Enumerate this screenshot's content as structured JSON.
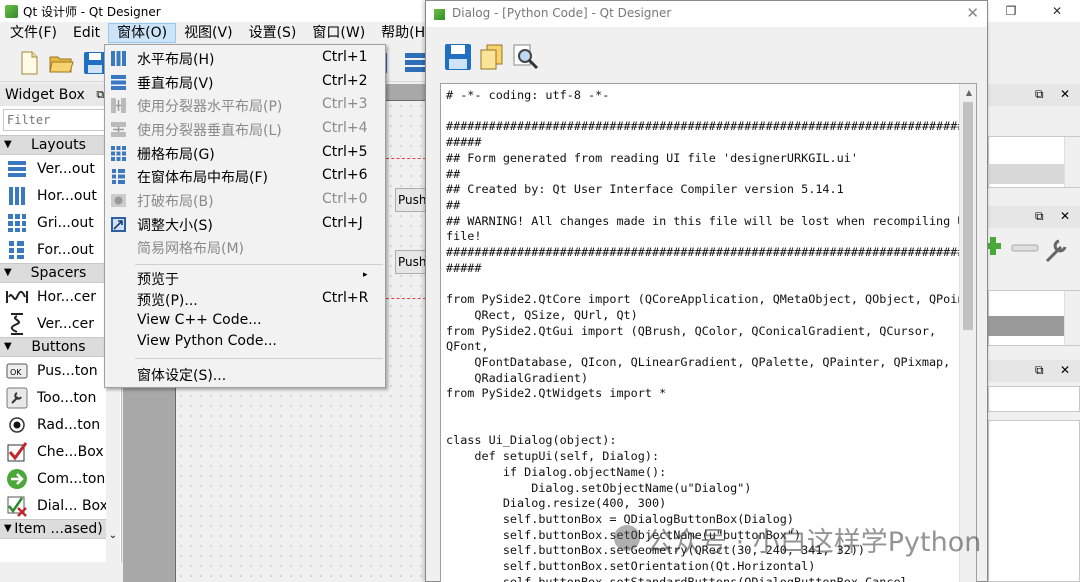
{
  "window": {
    "title": "Qt 设计师 - Qt Designer",
    "controls": [
      "—",
      "❐",
      "✕"
    ]
  },
  "menubar": {
    "items": [
      "文件(F)",
      "Edit",
      "窗体(O)",
      "视图(V)",
      "设置(S)",
      "窗口(W)",
      "帮助(H)"
    ],
    "active_index": 2
  },
  "widget_box": {
    "title": "Widget Box",
    "dock_buttons": "⧉ ✕",
    "filter_placeholder": "Filter",
    "categories": [
      {
        "name": "Layouts",
        "items": [
          "Ver...out",
          "Hor...out",
          "Gri...out",
          "For...out"
        ]
      },
      {
        "name": "Spacers",
        "items": [
          "Hor...cer",
          "Ver...cer"
        ]
      },
      {
        "name": "Buttons",
        "items": [
          "Pus...ton",
          "Too...ton",
          "Rad...ton",
          "Che...Box",
          "Com...ton",
          "Dial... Box"
        ]
      },
      {
        "name": "Item ...ased)",
        "items": []
      }
    ]
  },
  "form_menu": {
    "items": [
      {
        "label": "水平布局(H)",
        "shortcut": "Ctrl+1",
        "enabled": true,
        "icon": "horizontal-layout-icon"
      },
      {
        "label": "垂直布局(V)",
        "shortcut": "Ctrl+2",
        "enabled": true,
        "icon": "vertical-layout-icon"
      },
      {
        "label": "使用分裂器水平布局(P)",
        "shortcut": "Ctrl+3",
        "enabled": false,
        "icon": "splitter-horizontal-icon"
      },
      {
        "label": "使用分裂器垂直布局(L)",
        "shortcut": "Ctrl+4",
        "enabled": false,
        "icon": "splitter-vertical-icon"
      },
      {
        "label": "栅格布局(G)",
        "shortcut": "Ctrl+5",
        "enabled": true,
        "icon": "grid-layout-icon"
      },
      {
        "label": "在窗体布局中布局(F)",
        "shortcut": "Ctrl+6",
        "enabled": true,
        "icon": "form-layout-icon"
      },
      {
        "label": "打破布局(B)",
        "shortcut": "Ctrl+0",
        "enabled": false,
        "icon": "break-layout-icon"
      },
      {
        "label": "调整大小(S)",
        "shortcut": "Ctrl+J",
        "enabled": true,
        "icon": "adjust-size-icon"
      },
      {
        "label": "简易网格布局(M)",
        "shortcut": "",
        "enabled": false,
        "icon": ""
      },
      {
        "label": "预览于",
        "shortcut": "",
        "enabled": true,
        "icon": "",
        "submenu": true
      },
      {
        "label": "预览(P)...",
        "shortcut": "Ctrl+R",
        "enabled": true,
        "icon": ""
      },
      {
        "label": "View C++ Code...",
        "shortcut": "",
        "enabled": true,
        "icon": ""
      },
      {
        "label": "View Python Code...",
        "shortcut": "",
        "enabled": true,
        "icon": ""
      },
      {
        "label": "窗体设定(S)...",
        "shortcut": "",
        "enabled": true,
        "icon": ""
      }
    ]
  },
  "canvas": {
    "buttons": [
      "Push",
      "Push"
    ]
  },
  "dialog": {
    "title": "Dialog - [Python Code] - Qt Designer",
    "close": "✕",
    "toolbar": [
      "save-icon",
      "copy-icon",
      "find-icon"
    ],
    "code": "# -*- coding: utf-8 -*-\n\n################################################################################\n#####\n## Form generated from reading UI file 'designerURKGIL.ui'\n##\n## Created by: Qt User Interface Compiler version 5.14.1\n##\n## WARNING! All changes made in this file will be lost when recompiling UI\nfile!\n################################################################################\n#####\n\nfrom PySide2.QtCore import (QCoreApplication, QMetaObject, QObject, QPoint,\n    QRect, QSize, QUrl, Qt)\nfrom PySide2.QtGui import (QBrush, QColor, QConicalGradient, QCursor,\nQFont,\n    QFontDatabase, QIcon, QLinearGradient, QPalette, QPainter, QPixmap,\n    QRadialGradient)\nfrom PySide2.QtWidgets import *\n\n\nclass Ui_Dialog(object):\n    def setupUi(self, Dialog):\n        if Dialog.objectName():\n            Dialog.setObjectName(u\"Dialog\")\n        Dialog.resize(400, 300)\n        self.buttonBox = QDialogButtonBox(Dialog)\n        self.buttonBox.setObjectName(u\"buttonBox\")\n        self.buttonBox.setGeometry(QRect(30, 240, 341, 32))\n        self.buttonBox.setOrientation(Qt.Horizontal)\n        self.buttonBox.setStandardButtons(QDialogButtonBox.Cancel"
  },
  "right_docks": {
    "buttons": [
      "⧉",
      "✕"
    ]
  },
  "watermark": "公众号 · 小白这样学Python"
}
